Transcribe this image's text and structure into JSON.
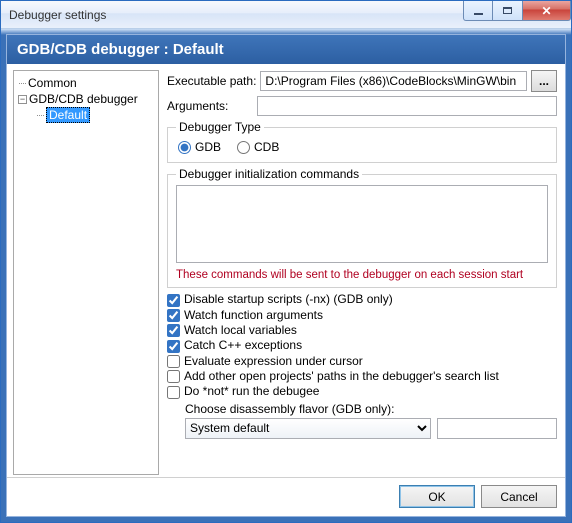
{
  "window": {
    "title": "Debugger settings"
  },
  "section_title": "GDB/CDB debugger : Default",
  "tree": {
    "common": "Common",
    "gdbcdb": "GDB/CDB debugger",
    "default": "Default"
  },
  "form": {
    "exec_label": "Executable path:",
    "exec_value": "D:\\Program Files (x86)\\CodeBlocks\\MinGW\\bin",
    "args_label": "Arguments:",
    "args_value": "",
    "debugger_type_legend": "Debugger Type",
    "radio_gdb": "GDB",
    "radio_cdb": "CDB",
    "init_legend": "Debugger initialization commands",
    "init_text": "",
    "init_warn": "These commands will be sent to the debugger on each session start",
    "chk_disable_startup": "Disable startup scripts (-nx) (GDB only)",
    "chk_watch_args": "Watch function arguments",
    "chk_watch_locals": "Watch local variables",
    "chk_catch_cpp": "Catch C++ exceptions",
    "chk_eval_cursor": "Evaluate expression under cursor",
    "chk_add_paths": "Add other open projects' paths in the debugger's search list",
    "chk_no_run": "Do *not* run the debugee",
    "disasm_label": "Choose disassembly flavor (GDB only):",
    "disasm_value": "System default",
    "extra_value": ""
  },
  "footer": {
    "ok": "OK",
    "cancel": "Cancel"
  }
}
